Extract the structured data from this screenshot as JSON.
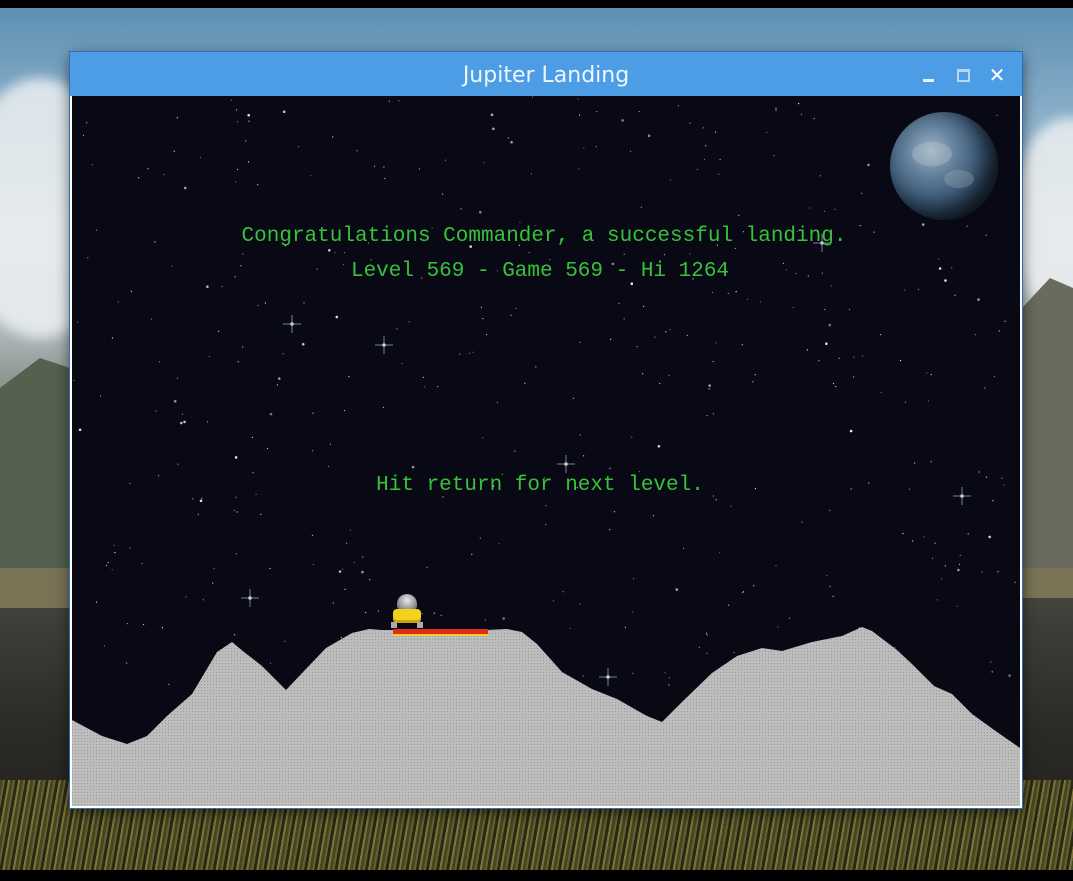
{
  "window": {
    "title": "Jupiter Landing",
    "controls": [
      "minimize-icon",
      "maximize-icon",
      "close-icon"
    ],
    "close_glyph": "✕"
  },
  "game": {
    "message_line1": "Congratulations Commander, a successful landing.",
    "message_line2": "Level 569 - Game 569 - Hi 1264",
    "message_line3": "Hit return for next level.",
    "level": 569,
    "game_number": 569,
    "high_score": 1264,
    "text_color": "#36c23a",
    "sky_color": "#090915",
    "terrain_color": "#b8b8b8",
    "pad_color": "#e02a1c"
  }
}
